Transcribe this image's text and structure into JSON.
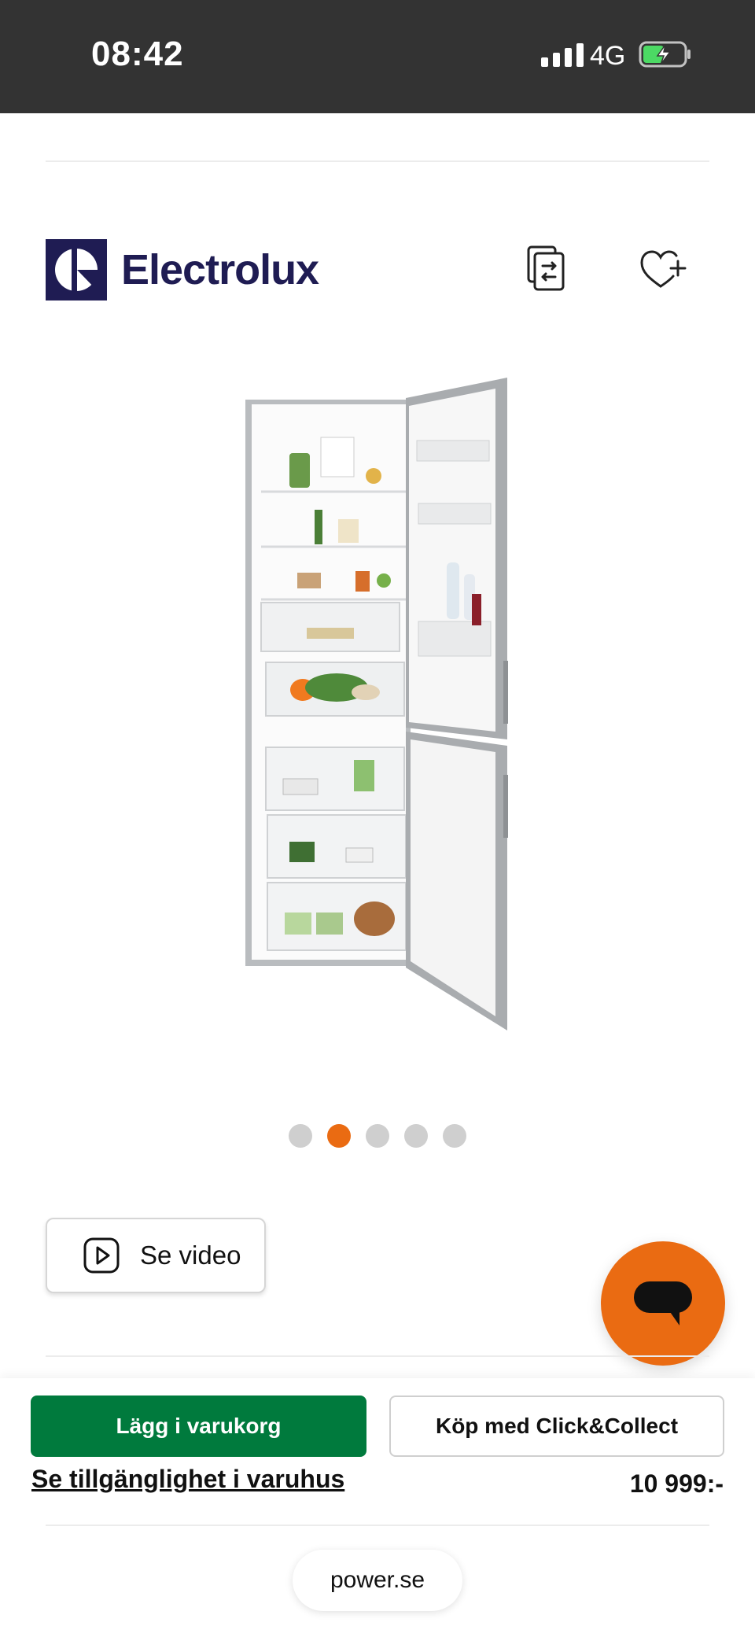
{
  "status_bar": {
    "time": "08:42",
    "network": "4G"
  },
  "brand": {
    "name": "Electrolux",
    "color": "#1f1c53"
  },
  "carousel": {
    "total": 5,
    "active_index": 1,
    "active_color": "#ea6b12"
  },
  "video_button": {
    "label": "Se video"
  },
  "actions": {
    "add_to_cart": "Lägg i varukorg",
    "click_collect": "Köp med Click&Collect",
    "availability": "Se tillgänglighet i varuhus",
    "price": "10 999:-",
    "primary_color": "#007a3d"
  },
  "browser": {
    "url": "power.se"
  }
}
